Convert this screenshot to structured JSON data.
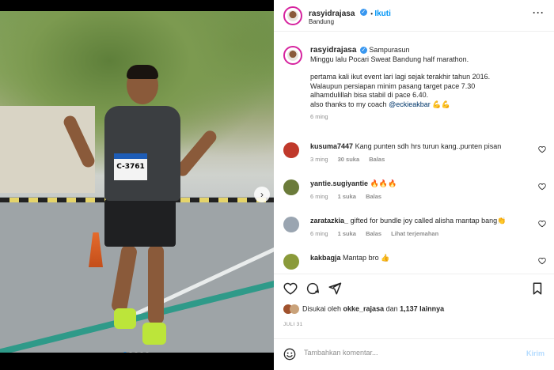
{
  "post": {
    "username": "rasyidrajasa",
    "follow_label": "Ikuti",
    "location": "Bandung",
    "more_label": "···"
  },
  "photo": {
    "bib_text": "C-3761"
  },
  "caption": {
    "username": "rasyidrajasa",
    "location_inline": "Sampurasun",
    "line1": "Minggu lalu Pocari Sweat Bandung half marathon.",
    "line2": "pertama kali ikut event lari lagi sejak terakhir tahun 2016.",
    "line3": "Walaupun persiapan minim pasang target pace 7.30",
    "line4": "alhamdulillah bisa stabil di pace 6.40.",
    "line5_prefix": "also thanks to my coach ",
    "mention": "@eckieakbar",
    "emoji": "💪💪",
    "time": "6 ming"
  },
  "comments": [
    {
      "username": "kusuma7447",
      "text": "Kang punten sdh hrs turun kang..punten pisan",
      "time": "3 ming",
      "likes": "30 suka",
      "reply": "Balas",
      "avatar_color": "#c0392b"
    },
    {
      "username": "yantie.sugiyantie",
      "text": "🔥🔥🔥",
      "time": "6 ming",
      "likes": "1 suka",
      "reply": "Balas",
      "avatar_color": "#6b7b3a"
    },
    {
      "username": "zaratazkia_",
      "text": "gifted for bundle joy called alisha mantap bang👏",
      "time": "6 ming",
      "likes": "1 suka",
      "reply": "Balas",
      "translate": "Lihat terjemahan",
      "avatar_color": "#9aa5b1"
    },
    {
      "username": "kakbagja",
      "text": "Mantap bro 👍",
      "time": "",
      "likes": "",
      "reply": "",
      "avatar_color": "#8a9a3a"
    }
  ],
  "actions": {
    "liked_prefix": "Disukai oleh ",
    "liked_user": "okke_rajasa",
    "liked_suffix": " dan ",
    "liked_count": "1,137 lainnya",
    "date": "JULI 31"
  },
  "add_comment": {
    "placeholder": "Tambahkan komentar...",
    "post_label": "Kirim"
  },
  "colors": {
    "link_blue": "#0095f6",
    "mention_blue": "#00376b",
    "muted": "#8e8e8e"
  }
}
